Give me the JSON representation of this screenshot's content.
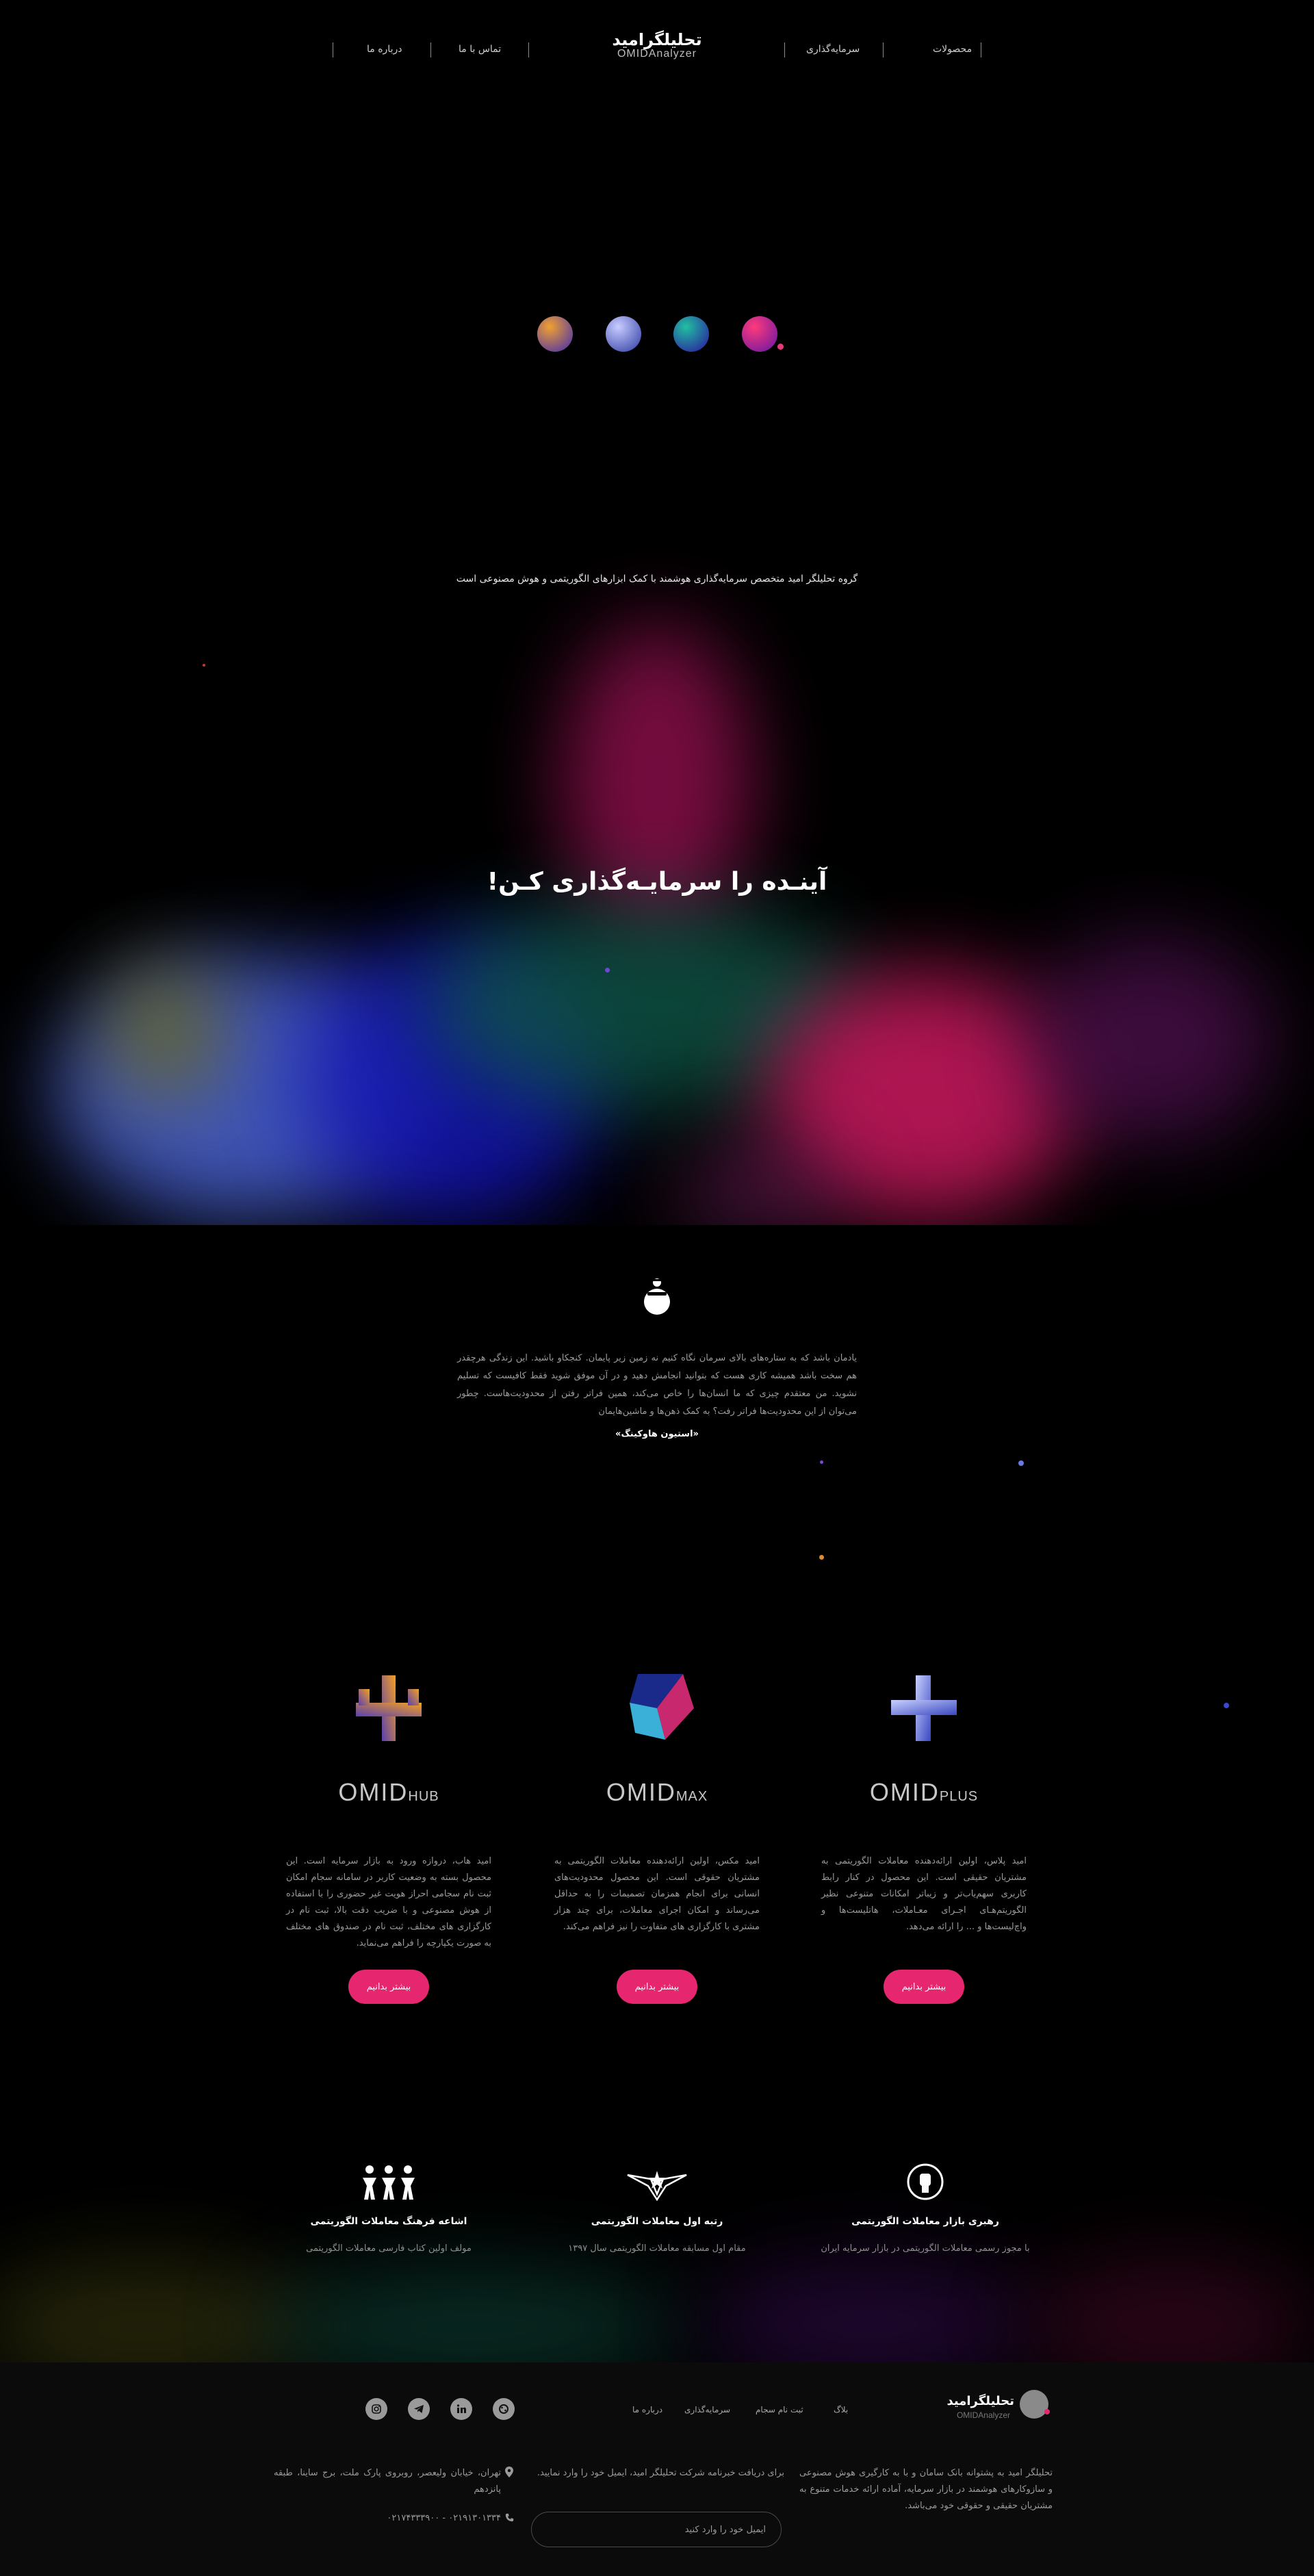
{
  "header": {
    "brand_fa": "تحلیلگرامید",
    "brand_en": "OMIDAnalyzer",
    "nav": [
      "محصولات",
      "سرمایه‌گذاری",
      "تماس با ما",
      "درباره ما"
    ]
  },
  "hero": {
    "subtitle": "گروه تحلیلگر امید متخصص سرمایه‌گذاری هوشمند با کمک ابزارهای الگوریتمی و هوش مصنوعی است",
    "title": "آینـده را سرمایـه‌گذاری کـن!"
  },
  "quote": {
    "text": "یادمان باشد که به ستاره‌های بالای سرمان نگاه کنیم نه زمین زیر پایمان. کنجکاو باشید. این زندگی هرچقدر هم سخت باشد همیشه کاری هست که بتوانید انجامش دهید و در آن موفق شوید فقط کافیست که تسلیم نشوید. من معتقدم چیزی که ما انسان‌ها را خاص می‌کند، همین فراتر رفتن از محدودیت‌هاست. چطور می‌توان از این محدودیت‌ها فراتر رفت؟ به کمک ذهن‌ها و ماشین‌هایمان",
    "author": "«استیون هاوکینگ»"
  },
  "products": [
    {
      "name_main": "OMID",
      "name_suffix": "HUB",
      "description": "امید هاب، دروازه ورود به بازار سرمایه است. این محصول بسته به وضعیت کاربر در سامانه سجام امکان ثبت نام سجامی احراز هویت غیر حضوری را با استفاده از هوش مصنوعی و با ضریب دقت بالا، ثبت نام در کارگزاری های مختلف، ثبت نام در صندوق های مختلف به صورت یکپارچه را فراهم می‌نماید.",
      "button": "بیشتر بدانیم"
    },
    {
      "name_main": "OMID",
      "name_suffix": "MAX",
      "description": "امید مکس، اولین ارائه‌دهنده معاملات الگوریتمی به مشتریان حقوقی است. این محصول محدودیت‌های انسانی برای انجام همزمان تصمیمات را به حداقل می‌رساند و امکان اجرای معاملات، برای چند هزار مشتری با کارگزاری های متفاوت را نیز فراهم می‌کند.",
      "button": "بیشتر بدانیم"
    },
    {
      "name_main": "OMID",
      "name_suffix": "PLUS",
      "description": "امید پلاس، اولین ارائه‌دهنده معاملات الگوریتمی به مشتریان حقیقی است. این محصول در کنار رابط کاربری سهم‌یاب‌تر و زیباتر امکانات متنوعی نظیر الگوریتم‌هـای اجـرای معـاملات، هاتلیست‌ها و واچ‌لیست‌ها و ... را ارائه می‌دهد.",
      "button": "بیشتر بدانیم"
    }
  ],
  "achievements": [
    {
      "title": "اشاعه فرهنگ معاملات الگوریتمی",
      "description": "مولف اولین کتاب فارسی معاملات الگوریتمی"
    },
    {
      "title": "رتبه اول معاملات الگوریتمی",
      "description": "مقام اول مسابقه معاملات الگوریتمی سال ۱۳۹۷"
    },
    {
      "title": "رهبری بازار معاملات الگوریتمی",
      "description": "با مجوز رسمی معاملات الگوریتمی در بازار سرمایه ایران"
    }
  ],
  "footer": {
    "brand_fa": "تحلیلگرامید",
    "brand_en": "OMIDAnalyzer",
    "links": [
      "بلاگ",
      "ثبت نام سجام",
      "سرمایه‌گذاری",
      "درباره ما"
    ],
    "social": [
      "instagram-icon",
      "telegram-icon",
      "linkedin-icon",
      "aparat-icon"
    ],
    "about": "تحلیلگر امید به پشتوانه بانک سامان و با به کارگیری هوش مصنوعی و سازوکارهای هوشمند در بازار سرمایه، آماده ارائه خدمات متنوع به مشتریان حقیقی و حقوقی خود می‌باشد.",
    "newsletter": "برای دریافت خبرنامه شرکت تحلیلگر امید، ایمیل خود را وارد نمایید.",
    "email_placeholder": "ایمیل خود را وارد کنید",
    "address": "تهران، خیابان ولیعصر، روبروی پارک ملت، برج ساینا، طبقه پانزدهم",
    "phone": "۰۲۱۹۱۳۰۱۳۳۴ - ۰۲۱۷۴۳۳۳۹۰۰"
  },
  "colors": {
    "accent": "#e6276f",
    "background": "#000000",
    "footer_bg": "#0b0b0b"
  }
}
